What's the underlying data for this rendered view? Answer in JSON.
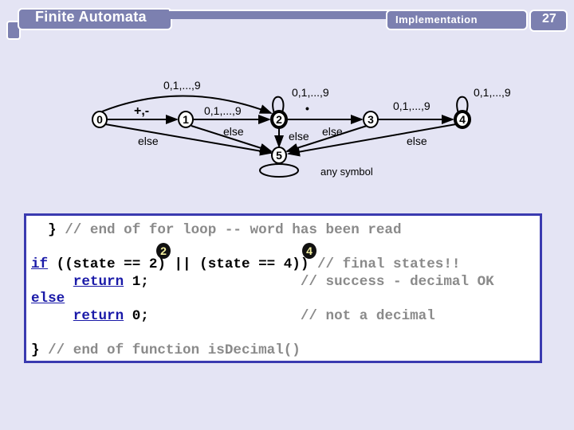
{
  "header": {
    "title": "Finite Automata",
    "section": "Implementation",
    "page_number": "27"
  },
  "diagram": {
    "states": [
      "0",
      "1",
      "2",
      "3",
      "4",
      "5"
    ],
    "final_states": [
      "2",
      "4"
    ],
    "labels": {
      "skip_0_2": "0,1,...,9",
      "sign": "+,-",
      "digits_1_2": "0,1,...,9",
      "loop_2": "0,1,...,9",
      "dot": "•",
      "digits_3_4": "0,1,...,9",
      "loop_4": "0,1,...,9",
      "else_0": "else",
      "else_1": "else",
      "else_2": "else",
      "else_3": "else",
      "else_4": "else",
      "loop_5": "any symbol"
    }
  },
  "code": {
    "l1_a": "  } ",
    "l1_c": "// end of for loop -- word has been read",
    "l2_kw": "if",
    "l2_a": " ((state == 2) || (state == 4)) ",
    "l2_c": "// final states!!",
    "l3_pre": "     ",
    "l3_kw": "return",
    "l3_a": " 1;                  ",
    "l3_c": "// success - decimal OK",
    "l4_kw": "else",
    "l5_pre": "     ",
    "l5_kw": "return",
    "l5_a": " 0;                  ",
    "l5_c": "// not a decimal",
    "l7_a": "} ",
    "l7_c": "// end of function isDecimal()",
    "badge_2": "2",
    "badge_4": "4"
  }
}
